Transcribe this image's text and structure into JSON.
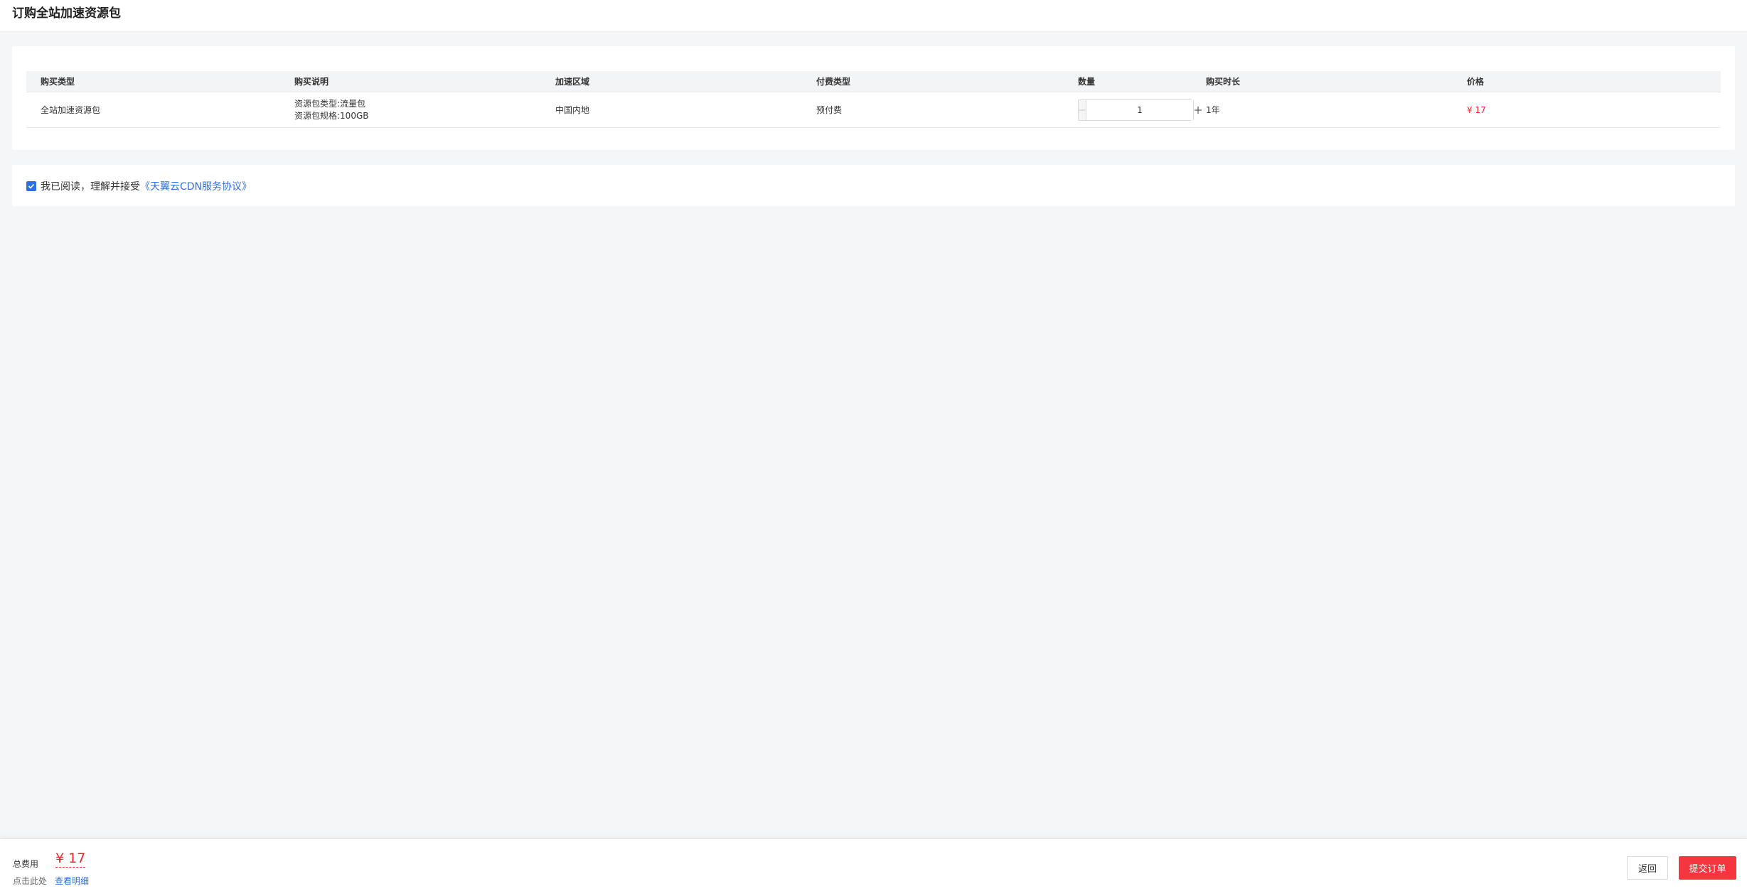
{
  "page": {
    "title": "订购全站加速资源包"
  },
  "table": {
    "headers": [
      "购买类型",
      "购买说明",
      "加速区域",
      "付费类型",
      "数量",
      "购买时长",
      "价格"
    ],
    "row": {
      "purchase_type": "全站加速资源包",
      "description_line1": "资源包类型:流量包",
      "description_line2": "资源包规格:100GB",
      "region": "中国内地",
      "payment_type": "预付费",
      "quantity": "1",
      "duration": "1年",
      "price": "¥ 17"
    }
  },
  "agreement": {
    "checked": true,
    "text": "我已阅读，理解并接受",
    "link_text": "《天翼云CDN服务协议》"
  },
  "footer": {
    "total_label": "总费用",
    "total_value": "¥ 17",
    "detail_hint": "点击此处",
    "detail_link": "查看明细",
    "back_label": "返回",
    "submit_label": "提交订单"
  },
  "colors": {
    "accent": "#2f6fe4",
    "price": "#f5222d",
    "submit": "#f5363f",
    "background": "#f5f6f8"
  },
  "icons": {
    "checkbox": "check-icon",
    "minus": "minus-icon",
    "plus": "plus-icon"
  }
}
